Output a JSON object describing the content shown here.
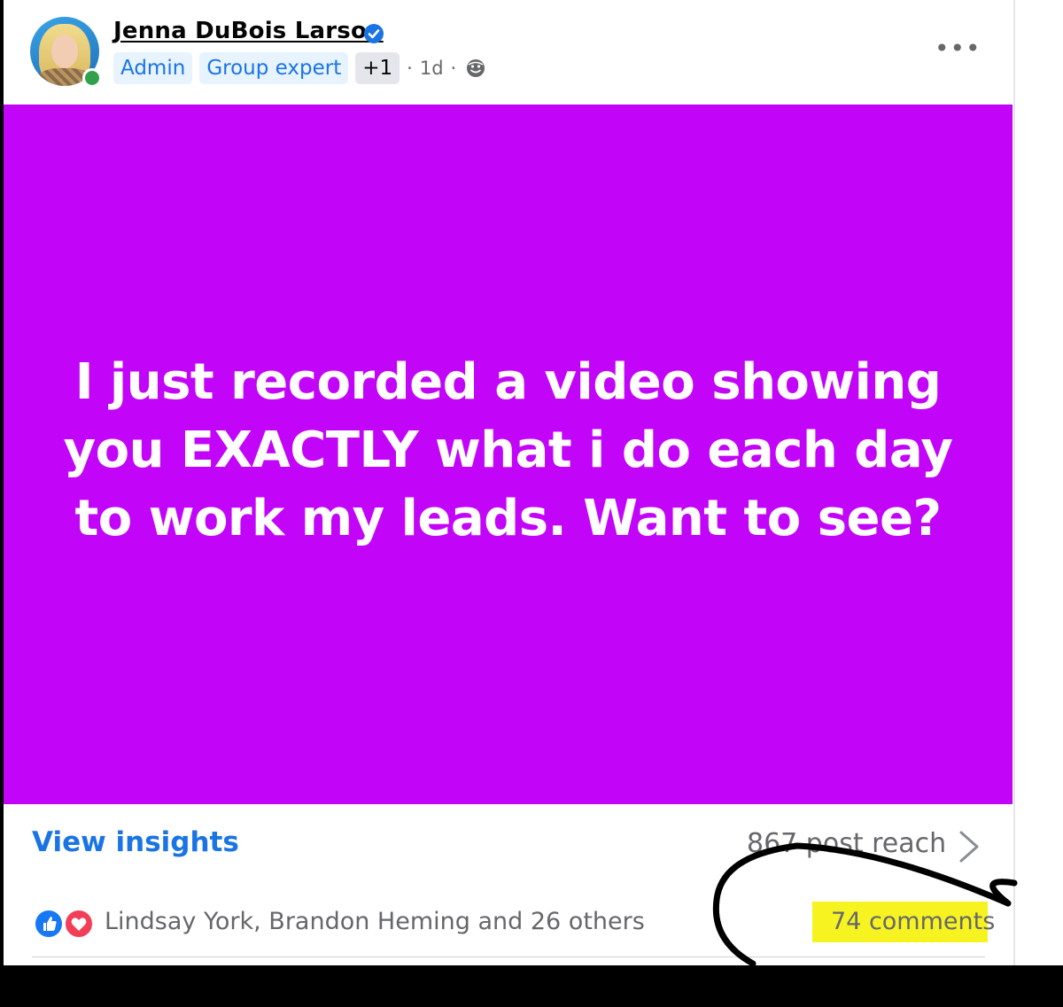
{
  "post": {
    "author": "Jenna DuBois Larson",
    "badges": [
      "Admin",
      "Group expert"
    ],
    "badge_extra": "+1",
    "separator": "·",
    "time": "1d",
    "text": "I just recorded a video showing you EXACTLY what i do each day to work my leads. Want to see?",
    "background_color": "#c205f8"
  },
  "footer": {
    "insights_label": "View insights",
    "reach": "867 post reach",
    "reaction_icons": [
      "like-icon",
      "love-icon"
    ],
    "likers": "Lindsay York, Brandon Heming and 26 others",
    "comments": "74 comments"
  },
  "icons": {
    "verified": "verified-badge-icon",
    "audience": "globe-icon",
    "more": "more-options-icon",
    "chevron": "chevron-right-icon"
  },
  "colors": {
    "accent": "#1b74e4",
    "highlight": "#f6f321"
  }
}
